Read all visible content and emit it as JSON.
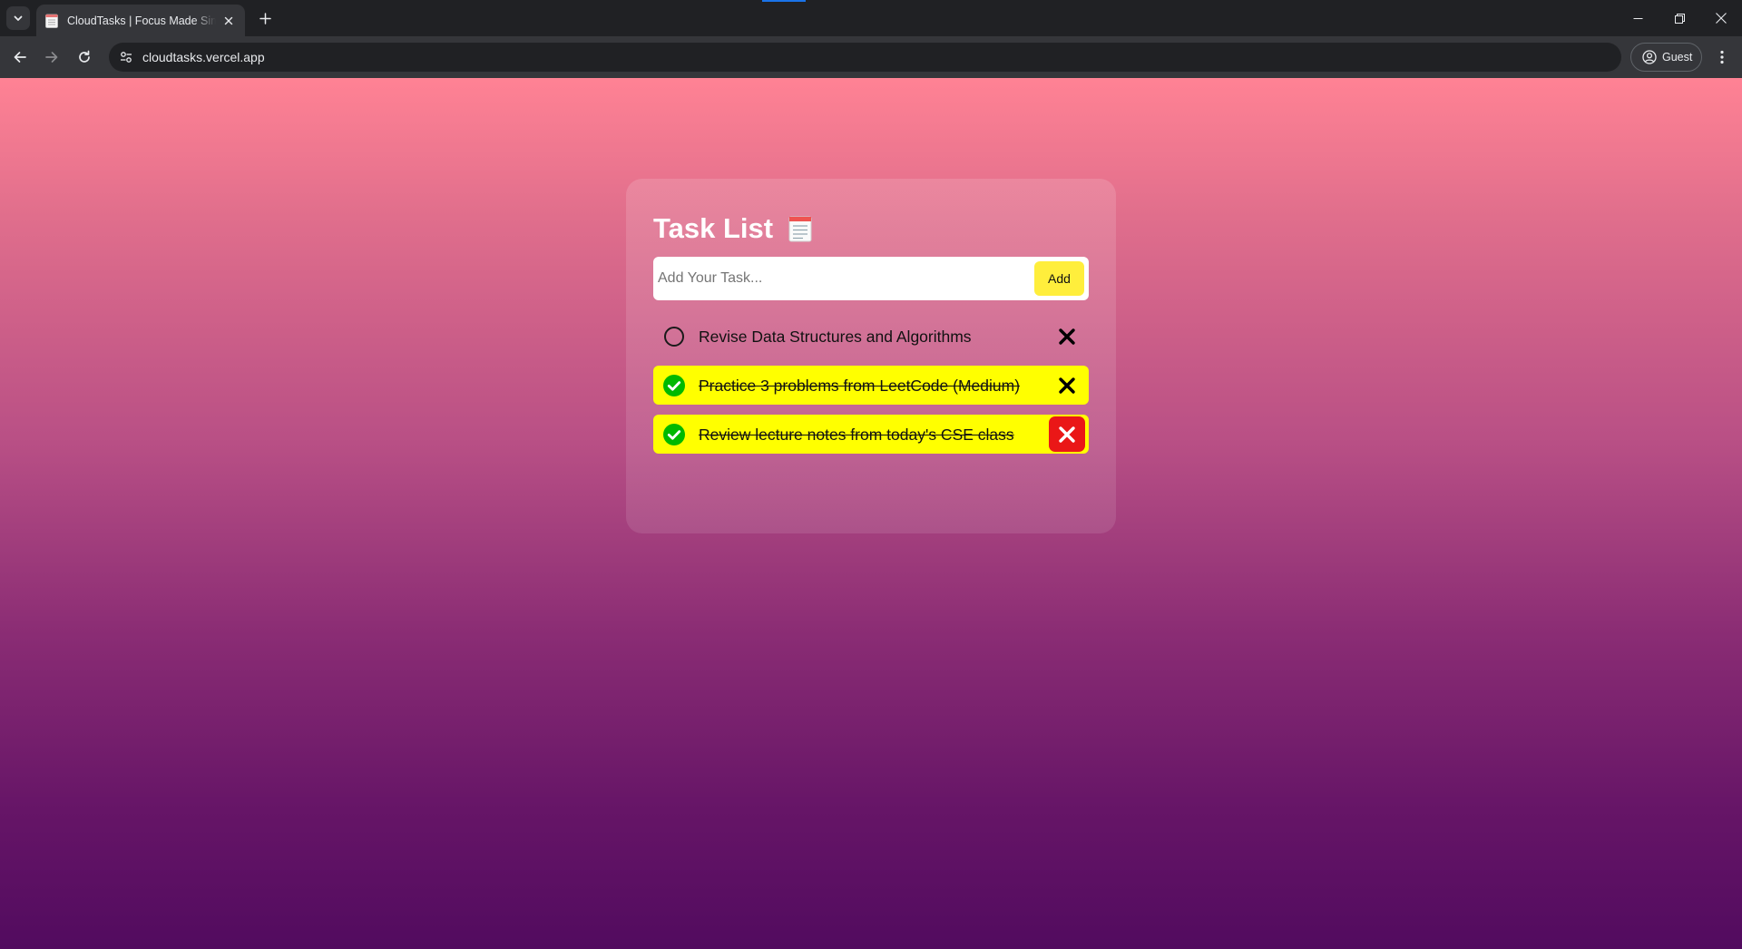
{
  "browser": {
    "tab_title": "CloudTasks | Focus Made Simple",
    "url": "cloudtasks.vercel.app",
    "profile_label": "Guest"
  },
  "app": {
    "title": "Task List",
    "title_icon": "notepad-icon",
    "input_placeholder": "Add Your Task...",
    "input_value": "",
    "add_button_label": "Add",
    "accent_color": "#ffff00",
    "delete_hover_color": "#ea1717",
    "tasks": [
      {
        "text": "Revise Data Structures and Algorithms",
        "completed": false
      },
      {
        "text": "Practice 3 problems from LeetCode (Medium)",
        "completed": true
      },
      {
        "text": "Review lecture notes from today's CSE class",
        "completed": true,
        "delete_hovered": true
      }
    ]
  }
}
